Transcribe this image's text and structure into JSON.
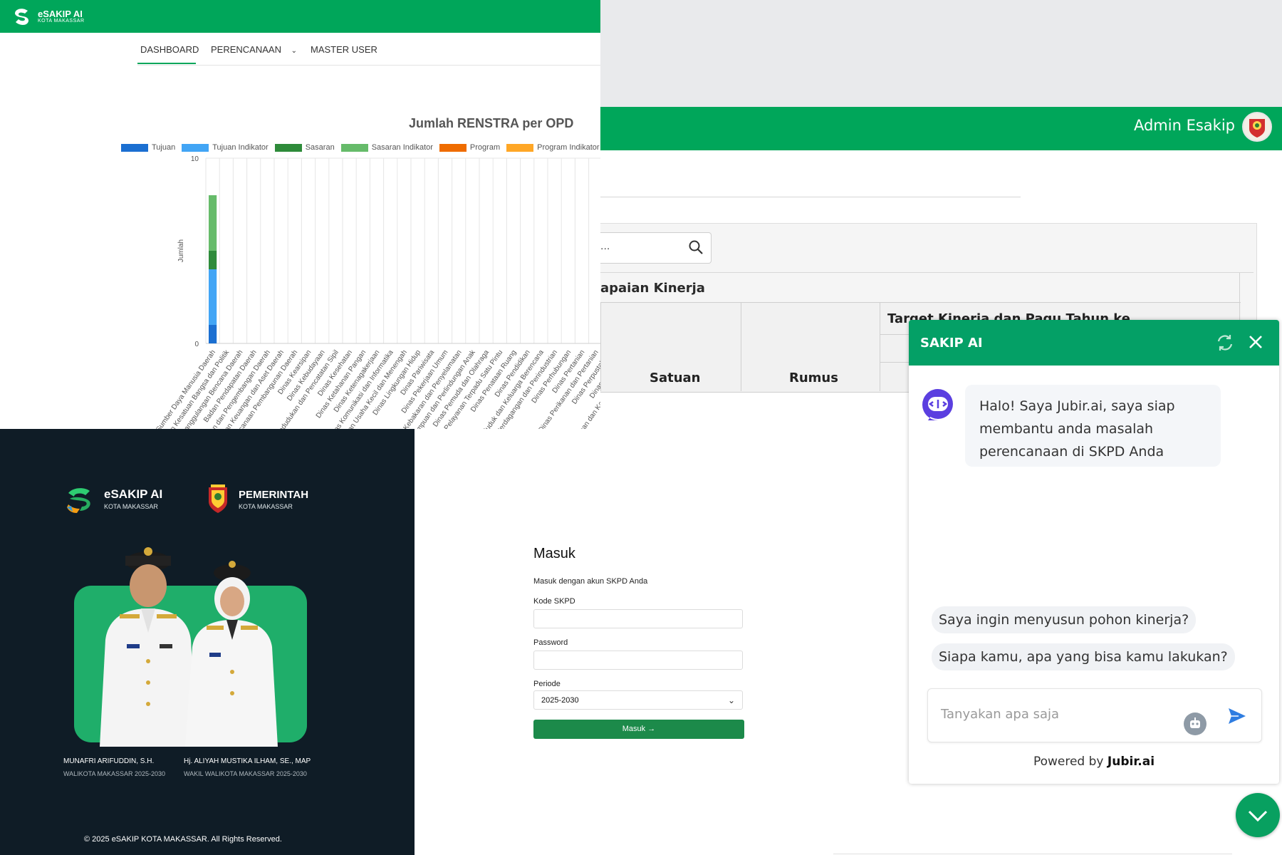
{
  "background_app": {
    "user_name": "Admin Esakip",
    "search_text": "...",
    "table_title": "apaian Kinerja",
    "columns": [
      "Satuan",
      "Rumus",
      "Target Kinerja dan Pagu Tahun ke"
    ],
    "colors": {
      "header": "#00a65a"
    }
  },
  "dashboard": {
    "logo_text": "eSAKIP AI",
    "logo_sub": "KOTA MAKASSAR",
    "nav": [
      "DASHBOARD",
      "PERENCANAAN",
      "MASTER USER"
    ],
    "active_tab": "DASHBOARD"
  },
  "chart_data": {
    "type": "bar",
    "title": "Jumlah RENSTRA per OPD",
    "ylabel": "Jumlah",
    "xlabel": "",
    "ylim": [
      0,
      10
    ],
    "yticks": [
      0,
      10
    ],
    "stacked": true,
    "legend": "top",
    "categories": [
      "Badan Sumber Daya Manusia Daerah",
      "Badan Kesatuan Bangsa dan Politik",
      "Badan Penanggulangan Bencana Daerah",
      "Badan Pendapatan Daerah",
      "Badan Penelitian dan Pengembangan Daerah",
      "Badan Pengelolaan Keuangan dan Aset Daerah",
      "Badan Perencanaan Pembangunan Daerah",
      "Dinas Kearsipan",
      "Dinas Kebudayaan",
      "Dinas Kependudukan dan Pencatatan Sipil",
      "Dinas Kesehatan",
      "Dinas Ketahanan Pangan",
      "Dinas Ketenagakerjaan",
      "Dinas Komunikasi dan Informatika",
      "Dinas Koperasi dan Usaha Kecil dan Menengah",
      "Dinas Lingkungan Hidup",
      "Dinas Pariwisata",
      "Dinas Pekerjaan Umum",
      "Dinas Pemadam Kebakaran dan Penyelamatan",
      "Dinas Pemberdayaan Perempuan dan Perlindungan Anak",
      "Dinas Pemuda dan Olahraga",
      "Dinas Penanaman Modal dan Pelayanan Terpadu Satu Pintu",
      "Dinas Penataan Ruang",
      "Dinas Pendidikan",
      "Dinas Pengendalian Penduduk dan Keluarga Berencana",
      "Dinas Perdagangan dan Perindustrian",
      "Dinas Perhubungan",
      "Dinas Pertanian",
      "Dinas Perikanan dan Pertanian",
      "Dinas Perpustakaan",
      "Dinas Pertanahan",
      "Dinas Perumahan dan Kawasan Permukiman",
      "Inspektorat",
      "Kecamatan"
    ],
    "series": [
      {
        "name": "Tujuan",
        "color": "#1b6fd1",
        "values": [
          1,
          0,
          0,
          0,
          0,
          0,
          0,
          0,
          0,
          0,
          0,
          0,
          0,
          0,
          0,
          0,
          0,
          0,
          0,
          0,
          0,
          0,
          0,
          0,
          0,
          0,
          0,
          0,
          0,
          0,
          0,
          0,
          0,
          0
        ]
      },
      {
        "name": "Tujuan Indikator",
        "color": "#42a5f5",
        "values": [
          3,
          0,
          0,
          0,
          0,
          0,
          0,
          0,
          0,
          0,
          0,
          0,
          0,
          0,
          0,
          0,
          0,
          0,
          0,
          0,
          0,
          0,
          0,
          0,
          0,
          0,
          0,
          0,
          0,
          0,
          0,
          0,
          0,
          0
        ]
      },
      {
        "name": "Sasaran",
        "color": "#2e8b3a",
        "values": [
          1,
          0,
          0,
          0,
          0,
          0,
          0,
          0,
          0,
          0,
          0,
          0,
          0,
          0,
          0,
          0,
          0,
          0,
          0,
          0,
          0,
          0,
          0,
          0,
          0,
          0,
          0,
          0,
          0,
          0,
          0,
          0,
          0,
          0
        ]
      },
      {
        "name": "Sasaran Indikator",
        "color": "#66bb6a",
        "values": [
          3,
          0,
          0,
          0,
          0,
          0,
          0,
          0,
          0,
          0,
          0,
          0,
          0,
          0,
          0,
          0,
          0,
          0,
          0,
          0,
          0,
          0,
          0,
          0,
          0,
          0,
          0,
          0,
          0,
          0,
          0,
          0,
          0,
          0
        ]
      },
      {
        "name": "Program",
        "color": "#ef6c00",
        "values": [
          0,
          0,
          0,
          0,
          0,
          0,
          0,
          0,
          0,
          0,
          0,
          0,
          0,
          0,
          0,
          0,
          0,
          0,
          0,
          0,
          0,
          0,
          0,
          0,
          0,
          0,
          0,
          0,
          0,
          0,
          0,
          0,
          0,
          0
        ]
      },
      {
        "name": "Program Indikator",
        "color": "#ffa726",
        "values": [
          0,
          0,
          0,
          0,
          0,
          0,
          0,
          0,
          0,
          0,
          0,
          0,
          0,
          0,
          0,
          0,
          0,
          0,
          0,
          0,
          0,
          0,
          0,
          0,
          0,
          0,
          0,
          0,
          0,
          0,
          0,
          0,
          0,
          0
        ]
      }
    ]
  },
  "login": {
    "brand_name": "eSAKIP AI",
    "brand_sub": "KOTA MAKASSAR",
    "gov_name": "PEMERINTAH",
    "gov_sub": "KOTA MAKASSAR",
    "official1_name": "MUNAFRI ARIFUDDIN, S.H.",
    "official1_role": "WALIKOTA MAKASSAR 2025-2030",
    "official2_name": "Hj. ALIYAH MUSTIKA ILHAM, SE., MAP",
    "official2_role": "WAKIL WALIKOTA MAKASSAR 2025-2030",
    "copyright": "© 2025 eSAKIP KOTA MAKASSAR. All Rights Reserved.",
    "title": "Masuk",
    "subtitle": "Masuk dengan akun SKPD Anda",
    "kode_label": "Kode SKPD",
    "kode_value": "",
    "password_label": "Password",
    "password_value": "",
    "periode_label": "Periode",
    "periode_value": "2025-2030",
    "submit_label": "Masuk →"
  },
  "chat": {
    "title": "SAKIP AI",
    "bot_message_lines": [
      "Halo! Saya Jubir.ai, saya siap",
      "membantu anda masalah",
      "perencanaan di SKPD Anda"
    ],
    "suggestions": [
      "Saya ingin menyusun pohon kinerja?",
      "Siapa kamu, apa yang bisa kamu lakukan?"
    ],
    "input_placeholder": "Tanyakan apa saja",
    "powered_prefix": "Powered by",
    "powered_brand": "Jubir.ai",
    "colors": {
      "header": "#04a066",
      "send": "#2f7de1"
    }
  }
}
